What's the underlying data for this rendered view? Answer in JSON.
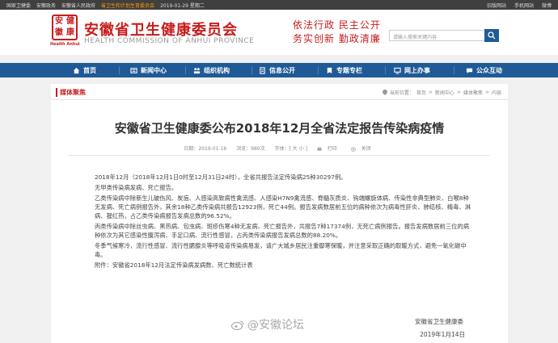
{
  "topbar": {
    "links": [
      "国家卫健委",
      "安徽政务",
      "安徽省人民政府",
      "省卫生和计划生育委员会"
    ],
    "date": "2019-01-29 星期二",
    "right_links": [
      "旧版网站",
      "手机网站",
      "微博"
    ]
  },
  "header": {
    "logo_chars": [
      "安",
      "健",
      "徽",
      "康"
    ],
    "logo_sub": "Health Anhui",
    "title": "安徽省卫生健康委员会",
    "title_en": "HEALTH COMMISSION OF ANHUI PROVINCE",
    "slogan_line1": "依法行政  民主公开",
    "slogan_line2": "务实创新  勤政清廉",
    "search_placeholder": "请输入搜索关键内容"
  },
  "nav": {
    "items": [
      "首页",
      "新闻中心",
      "组织机构",
      "信息公开",
      "专题专栏",
      "网上办事",
      "公众互动"
    ]
  },
  "breadcrumb": {
    "tag": "媒体聚焦",
    "path": [
      "当前位置：",
      "首页",
      ">",
      "新闻中心",
      ">",
      "媒体聚焦",
      ">",
      "内容"
    ]
  },
  "article": {
    "title": "安徽省卫生健康委公布2018年12月全省法定报告传染病疫情",
    "date": "日期：2019-01-16",
    "views": "浏览：980次",
    "font": "字体：[ 大 小 ]",
    "print": "打印",
    "close": "关闭",
    "paragraphs": [
      "2018年12月（2018年12月1日0时至12月31日24时），全省共报告法定传染病25种30297例。",
      "无甲类传染病发病、死亡报告。",
      "乙类传染病中除新生儿破伤风、炭疽、人感染高致病性禽流感、人感染H7N9禽流感、脊髓灰质炎、钩端螺旋体病、传染性非典型肺炎、白喉8种无发病、死亡病例报告外，其余18种乙类传染病共报告12923例，死亡44例。报告发病数居前五位的病种依次为病毒性肝炎、肺结核、梅毒、淋病、猩红热，占乙类传染病报告发病总数的96.52%。",
      "丙类传染病中除丝虫病、黑热病、包虫病、斑疹伤寒4种无发病、死亡报告外，共报告7种17374例，无死亡病例报告。报告发病数居前三位的病种依次为其它感染性腹泻病、手足口病、流行性感冒，占丙类传染病报告发病总数的88.20%。",
      "冬季气候寒冷，流行性感冒、流行性腮腺炎等呼吸道传染病易发，请广大城乡居民注重御寒保暖，并注意采取正确的取暖方式，避免一氧化碳中毒。",
      "附件：安徽省2018年12月法定传染病发病数、死亡数统计表"
    ],
    "sign_org": "安徽省卫生健康委",
    "sign_date": "2019年1月14日"
  },
  "watermark": "@安徽论坛",
  "colors": {
    "brand_red": "#c81d1d",
    "nav_blue": "#1f5a96"
  }
}
